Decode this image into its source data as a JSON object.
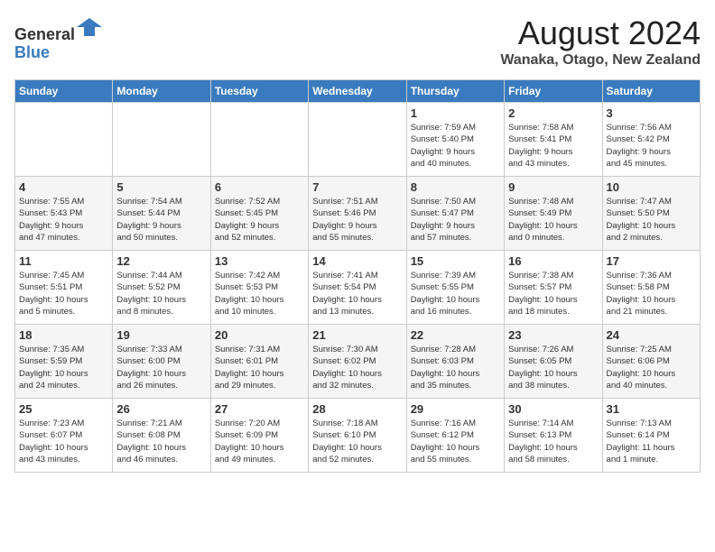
{
  "header": {
    "logo_line1": "General",
    "logo_line2": "Blue",
    "month_title": "August 2024",
    "location": "Wanaka, Otago, New Zealand"
  },
  "weekdays": [
    "Sunday",
    "Monday",
    "Tuesday",
    "Wednesday",
    "Thursday",
    "Friday",
    "Saturday"
  ],
  "weeks": [
    [
      {
        "day": "",
        "info": ""
      },
      {
        "day": "",
        "info": ""
      },
      {
        "day": "",
        "info": ""
      },
      {
        "day": "",
        "info": ""
      },
      {
        "day": "1",
        "info": "Sunrise: 7:59 AM\nSunset: 5:40 PM\nDaylight: 9 hours\nand 40 minutes."
      },
      {
        "day": "2",
        "info": "Sunrise: 7:58 AM\nSunset: 5:41 PM\nDaylight: 9 hours\nand 43 minutes."
      },
      {
        "day": "3",
        "info": "Sunrise: 7:56 AM\nSunset: 5:42 PM\nDaylight: 9 hours\nand 45 minutes."
      }
    ],
    [
      {
        "day": "4",
        "info": "Sunrise: 7:55 AM\nSunset: 5:43 PM\nDaylight: 9 hours\nand 47 minutes."
      },
      {
        "day": "5",
        "info": "Sunrise: 7:54 AM\nSunset: 5:44 PM\nDaylight: 9 hours\nand 50 minutes."
      },
      {
        "day": "6",
        "info": "Sunrise: 7:52 AM\nSunset: 5:45 PM\nDaylight: 9 hours\nand 52 minutes."
      },
      {
        "day": "7",
        "info": "Sunrise: 7:51 AM\nSunset: 5:46 PM\nDaylight: 9 hours\nand 55 minutes."
      },
      {
        "day": "8",
        "info": "Sunrise: 7:50 AM\nSunset: 5:47 PM\nDaylight: 9 hours\nand 57 minutes."
      },
      {
        "day": "9",
        "info": "Sunrise: 7:48 AM\nSunset: 5:49 PM\nDaylight: 10 hours\nand 0 minutes."
      },
      {
        "day": "10",
        "info": "Sunrise: 7:47 AM\nSunset: 5:50 PM\nDaylight: 10 hours\nand 2 minutes."
      }
    ],
    [
      {
        "day": "11",
        "info": "Sunrise: 7:45 AM\nSunset: 5:51 PM\nDaylight: 10 hours\nand 5 minutes."
      },
      {
        "day": "12",
        "info": "Sunrise: 7:44 AM\nSunset: 5:52 PM\nDaylight: 10 hours\nand 8 minutes."
      },
      {
        "day": "13",
        "info": "Sunrise: 7:42 AM\nSunset: 5:53 PM\nDaylight: 10 hours\nand 10 minutes."
      },
      {
        "day": "14",
        "info": "Sunrise: 7:41 AM\nSunset: 5:54 PM\nDaylight: 10 hours\nand 13 minutes."
      },
      {
        "day": "15",
        "info": "Sunrise: 7:39 AM\nSunset: 5:55 PM\nDaylight: 10 hours\nand 16 minutes."
      },
      {
        "day": "16",
        "info": "Sunrise: 7:38 AM\nSunset: 5:57 PM\nDaylight: 10 hours\nand 18 minutes."
      },
      {
        "day": "17",
        "info": "Sunrise: 7:36 AM\nSunset: 5:58 PM\nDaylight: 10 hours\nand 21 minutes."
      }
    ],
    [
      {
        "day": "18",
        "info": "Sunrise: 7:35 AM\nSunset: 5:59 PM\nDaylight: 10 hours\nand 24 minutes."
      },
      {
        "day": "19",
        "info": "Sunrise: 7:33 AM\nSunset: 6:00 PM\nDaylight: 10 hours\nand 26 minutes."
      },
      {
        "day": "20",
        "info": "Sunrise: 7:31 AM\nSunset: 6:01 PM\nDaylight: 10 hours\nand 29 minutes."
      },
      {
        "day": "21",
        "info": "Sunrise: 7:30 AM\nSunset: 6:02 PM\nDaylight: 10 hours\nand 32 minutes."
      },
      {
        "day": "22",
        "info": "Sunrise: 7:28 AM\nSunset: 6:03 PM\nDaylight: 10 hours\nand 35 minutes."
      },
      {
        "day": "23",
        "info": "Sunrise: 7:26 AM\nSunset: 6:05 PM\nDaylight: 10 hours\nand 38 minutes."
      },
      {
        "day": "24",
        "info": "Sunrise: 7:25 AM\nSunset: 6:06 PM\nDaylight: 10 hours\nand 40 minutes."
      }
    ],
    [
      {
        "day": "25",
        "info": "Sunrise: 7:23 AM\nSunset: 6:07 PM\nDaylight: 10 hours\nand 43 minutes."
      },
      {
        "day": "26",
        "info": "Sunrise: 7:21 AM\nSunset: 6:08 PM\nDaylight: 10 hours\nand 46 minutes."
      },
      {
        "day": "27",
        "info": "Sunrise: 7:20 AM\nSunset: 6:09 PM\nDaylight: 10 hours\nand 49 minutes."
      },
      {
        "day": "28",
        "info": "Sunrise: 7:18 AM\nSunset: 6:10 PM\nDaylight: 10 hours\nand 52 minutes."
      },
      {
        "day": "29",
        "info": "Sunrise: 7:16 AM\nSunset: 6:12 PM\nDaylight: 10 hours\nand 55 minutes."
      },
      {
        "day": "30",
        "info": "Sunrise: 7:14 AM\nSunset: 6:13 PM\nDaylight: 10 hours\nand 58 minutes."
      },
      {
        "day": "31",
        "info": "Sunrise: 7:13 AM\nSunset: 6:14 PM\nDaylight: 11 hours\nand 1 minute."
      }
    ]
  ]
}
